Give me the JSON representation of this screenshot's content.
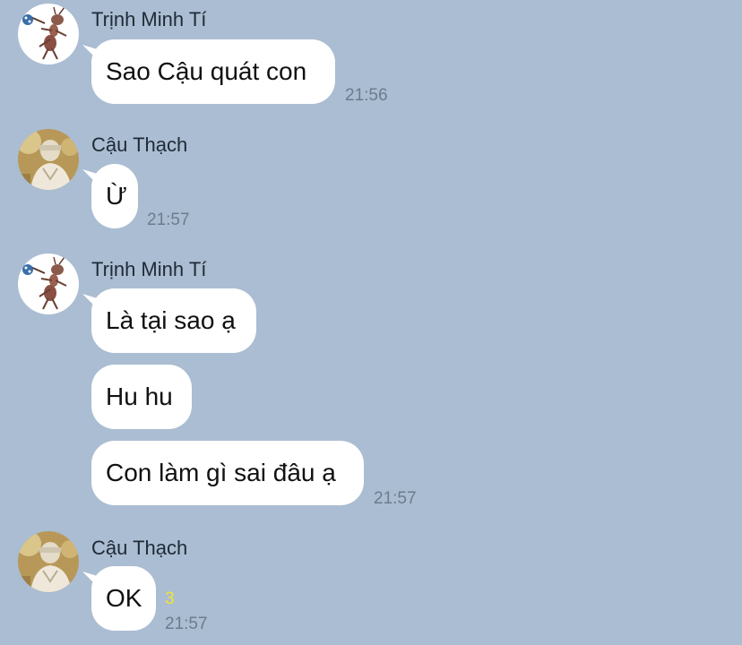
{
  "colors": {
    "background": "#aabdd2",
    "bubble": "#ffffff",
    "timestamp": "#6e7c8c",
    "read_count": "#f2e52e"
  },
  "messages": [
    {
      "sender": "Trịnh Minh Tí",
      "avatar_icon": "cartoon-ant-with-bindle-icon",
      "bubbles": [
        "Sao Cậu quát con"
      ],
      "time": "21:56"
    },
    {
      "sender": "Cậu Thạch",
      "avatar_icon": "person-photo-avatar-icon",
      "bubbles": [
        "Ừ"
      ],
      "time": "21:57"
    },
    {
      "sender": "Trịnh Minh Tí",
      "avatar_icon": "cartoon-ant-with-bindle-icon",
      "bubbles": [
        "Là tại sao ạ",
        "Hu hu",
        "Con làm gì sai đâu ạ"
      ],
      "time": "21:57"
    },
    {
      "sender": "Cậu Thạch",
      "avatar_icon": "person-photo-avatar-icon",
      "bubbles": [
        "OK"
      ],
      "read_count": "3",
      "time": "21:57"
    }
  ]
}
